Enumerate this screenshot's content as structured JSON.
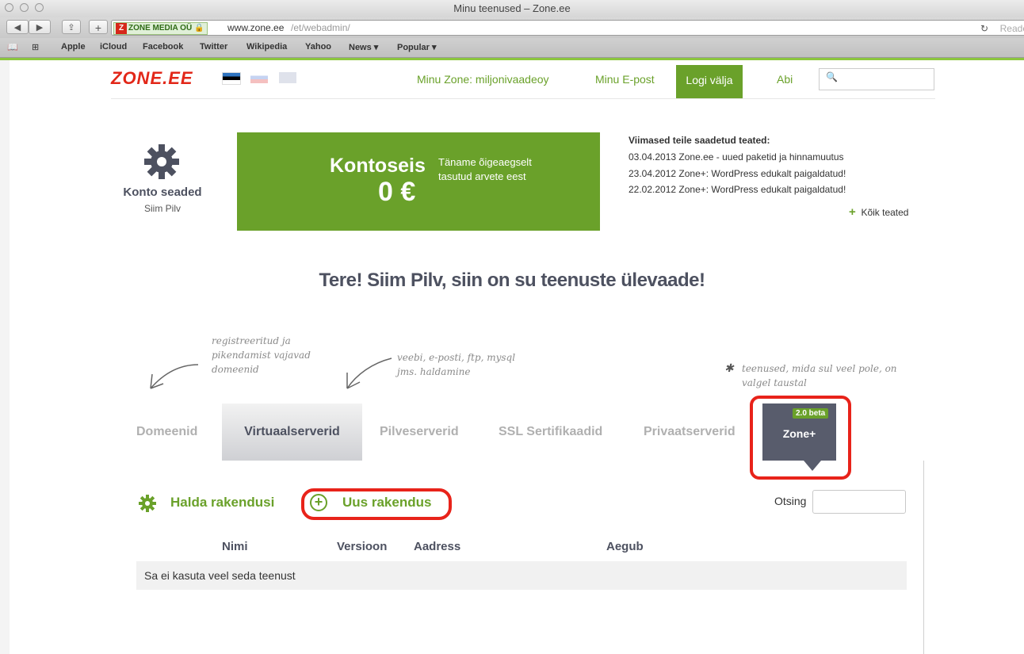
{
  "browser": {
    "title": "Minu teenused – Zone.ee",
    "site_badge": "ZONE MEDIA OÜ",
    "url_host": "www.zone.ee",
    "url_path": "/et/webadmin/",
    "reader": "Reade",
    "bookmarks": [
      "Apple",
      "iCloud",
      "Facebook",
      "Twitter",
      "Wikipedia",
      "Yahoo",
      "News ▾",
      "Popular ▾"
    ]
  },
  "header": {
    "logo": "ZONE.EE",
    "nav": {
      "my_zone": "Minu Zone: miljonivaadeoy",
      "my_email": "Minu E-post",
      "logout": "Logi välja",
      "help": "Abi"
    }
  },
  "account": {
    "title": "Konto seaded",
    "name": "Siim Pilv"
  },
  "balance": {
    "title": "Kontoseis",
    "amount": "0 €",
    "note": "Täname õigeaegselt tasutud arvete eest"
  },
  "notices": {
    "heading": "Viimased teile saadetud teated:",
    "items": [
      {
        "date": "03.04.2013",
        "text": "Zone.ee - uued paketid ja hinnamuutus"
      },
      {
        "date": "23.04.2012",
        "text": "Zone+: WordPress edukalt paigaldatud!"
      },
      {
        "date": "22.02.2012",
        "text": "Zone+: WordPress edukalt paigaldatud!"
      }
    ],
    "all": "Kõik teated"
  },
  "greeting": "Tere! Siim Pilv, siin on su teenuste ülevaade!",
  "hints": {
    "domains": "registreeritud ja pikendamist vajavad domeenid",
    "servers": "veebi, e-posti, ftp, mysql jms. haldamine",
    "missing": "teenused, mida sul veel pole, on valgel taustal"
  },
  "tabs": {
    "domains": "Domeenid",
    "virtual": "Virtuaalserverid",
    "cloud": "Pilveserverid",
    "ssl": "SSL Sertifikaadid",
    "private": "Privaatserverid",
    "zoneplus": "Zone+",
    "beta": "2.0 beta"
  },
  "actions": {
    "manage": "Halda rakendusi",
    "new": "Uus rakendus",
    "search": "Otsing"
  },
  "table": {
    "columns": [
      "Nimi",
      "Versioon",
      "Aadress",
      "Aegub"
    ],
    "empty": "Sa ei kasuta veel seda teenust"
  }
}
